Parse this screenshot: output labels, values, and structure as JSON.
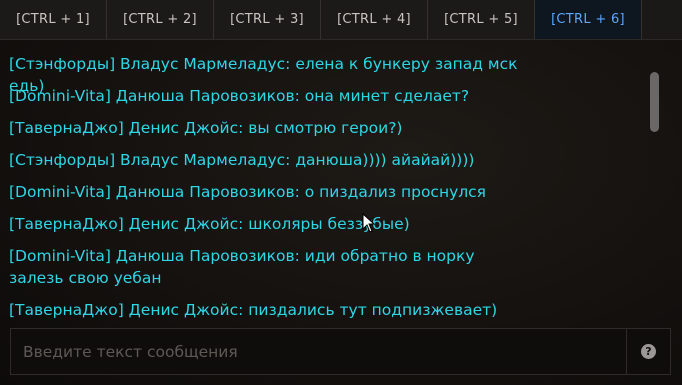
{
  "tabs": [
    {
      "label": "[CTRL + 1]"
    },
    {
      "label": "[CTRL + 2]"
    },
    {
      "label": "[CTRL + 3]"
    },
    {
      "label": "[CTRL + 4]"
    },
    {
      "label": "[CTRL + 5]"
    },
    {
      "label": "[CTRL + 6]"
    }
  ],
  "active_tab": 5,
  "messages": [
    {
      "text": "[Стэнфорды] Владус Мармеладус: елена к бункеру запад мск едь)"
    },
    {
      "text": "[Domini-Vita] Данюша Паровозиков: она минет сделает?"
    },
    {
      "text": "[ТавернаДжо] Денис Джойс: вы смотрю герои?)"
    },
    {
      "text": "[Стэнфорды] Владус Мармеладус: данюша)))) айайай))))"
    },
    {
      "text": "[Domini-Vita] Данюша Паровозиков: о пиздализ проснулся"
    },
    {
      "text": "[ТавернаДжо] Денис Джойс: школяры беззубые)"
    },
    {
      "text": "[Domini-Vita] Данюша Паровозиков: иди обратно в норку залезь свою уебан"
    },
    {
      "text": "[ТавернаДжо] Денис Джойс: пиздались тут подпизжевает)"
    }
  ],
  "input": {
    "placeholder": "Введите текст сообщения",
    "value": ""
  },
  "colors": {
    "message_text": "#2ed6e6",
    "active_tab_text": "#5aa8ff",
    "tab_text": "#c8c4bf"
  },
  "icons": {
    "help": "question-circle-icon"
  }
}
